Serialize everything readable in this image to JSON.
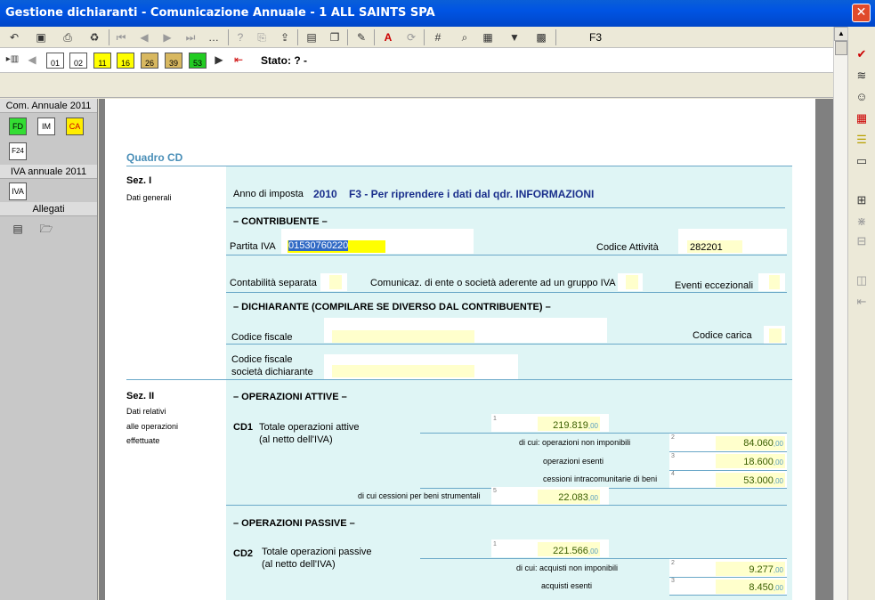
{
  "window": {
    "title": "Gestione dichiaranti - Comunicazione Annuale - 1 ALL SAINTS SPA",
    "close": "✕"
  },
  "toolbar1": {
    "f3": "F3"
  },
  "toolbar2": {
    "buttons": [
      "01",
      "02",
      "11",
      "16",
      "26",
      "39",
      "53"
    ],
    "stato": "Stato: ? -"
  },
  "sidebar": {
    "com_annuale": "Com. Annuale 2011",
    "docs": [
      "FD",
      "IM",
      "CA",
      "F24"
    ],
    "iva_annuale": "IVA annuale 2011",
    "iva_doc": "IVA",
    "allegati": "Allegati"
  },
  "form": {
    "quadro": "Quadro CD",
    "sez1": {
      "title": "Sez. I",
      "subtitle": "Dati generali"
    },
    "anno_label": "Anno di imposta",
    "anno_value": "2010",
    "anno_hint": "F3 - Per riprendere i dati dal qdr. INFORMAZIONI",
    "contribuente": "– CONTRIBUENTE –",
    "partita_iva_label": "Partita IVA",
    "partita_iva": "01530760220",
    "codice_attivita_label": "Codice Attività",
    "codice_attivita": "282201",
    "contabilita_label": "Contabilità separata",
    "comunicaz_label": "Comunicaz. di ente o società aderente ad un gruppo IVA",
    "eventi_label": "Eventi eccezionali",
    "dichiarante": "– DICHIARANTE (COMPILARE SE DIVERSO DAL CONTRIBUENTE) –",
    "codice_fiscale_label": "Codice fiscale",
    "codice_carica_label": "Codice carica",
    "cf_societa_label1": "Codice fiscale",
    "cf_societa_label2": "società dichiarante",
    "sez2": {
      "title": "Sez. II",
      "line1": "Dati relativi",
      "line2": "alle operazioni",
      "line3": "effettuate"
    },
    "op_attive": "– OPERAZIONI ATTIVE –",
    "cd1": {
      "code": "CD1",
      "label1": "Totale operazioni attive",
      "label2": "(al netto dell'IVA)",
      "total": "219.819",
      "non_imponibili_label": "di cui: operazioni non imponibili",
      "non_imponibili": "84.060",
      "esenti_label": "operazioni esenti",
      "esenti": "18.600",
      "intracom_label": "cessioni intracomunitarie di beni",
      "intracom": "53.000",
      "strumentali_label": "di cui cessioni per beni strumentali",
      "strumentali": "22.083"
    },
    "op_passive": "– OPERAZIONI PASSIVE –",
    "cd2": {
      "code": "CD2",
      "label1": "Totale operazioni passive",
      "label2": "(al netto dell'IVA)",
      "total": "221.566",
      "non_imponibili_label": "di cui: acquisti non imponibili",
      "non_imponibili": "9.277",
      "esenti_label": "acquisti esenti",
      "esenti": "8.450"
    },
    "dec": ",00",
    "idx": [
      "1",
      "2",
      "3",
      "4",
      "5"
    ]
  }
}
